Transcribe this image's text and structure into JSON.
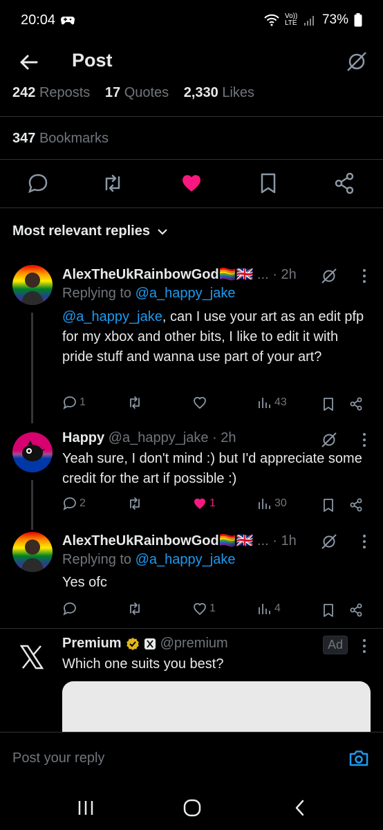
{
  "status_bar": {
    "time": "20:04",
    "network": "Vo)) LTE",
    "battery": "73%"
  },
  "header": {
    "title": "Post"
  },
  "stats": {
    "reposts_count": "242",
    "reposts_label": "Reposts",
    "quotes_count": "17",
    "quotes_label": "Quotes",
    "likes_count": "2,330",
    "likes_label": "Likes",
    "bookmarks_count": "347",
    "bookmarks_label": "Bookmarks"
  },
  "sort": {
    "label": "Most relevant replies"
  },
  "replies": [
    {
      "name": "AlexTheUkRainbowGod🏳️‍🌈🇬🇧",
      "meta": " ... · 2h",
      "replying_prefix": "Replying to ",
      "replying_to": "@a_happy_jake",
      "text_mention": "@a_happy_jake",
      "text": ", can I use your art as an edit pfp for my xbox and other bits, I like to edit it with pride stuff and wanna use part of your art?",
      "replies": "1",
      "reposts": "",
      "likes": "",
      "views": "43"
    },
    {
      "name": "Happy",
      "meta": " @a_happy_jake · 2h",
      "text": "Yeah sure, I don't mind :) but I'd appreciate some credit for the art if possible :)",
      "replies": "2",
      "reposts": "",
      "likes": "1",
      "views": "30"
    },
    {
      "name": "AlexTheUkRainbowGod🏳️‍🌈🇬🇧",
      "meta": " ... · 1h",
      "replying_prefix": "Replying to ",
      "replying_to": "@a_happy_jake",
      "text": "Yes ofc",
      "replies": "",
      "reposts": "",
      "likes": "1",
      "views": "4"
    }
  ],
  "ad": {
    "name": "Premium",
    "handle": "@premium",
    "badge": "Ad",
    "text": "Which one suits you best?"
  },
  "compose": {
    "placeholder": "Post your reply"
  },
  "colors": {
    "accent": "#1d9bf0",
    "like": "#f91880",
    "muted": "#71767b",
    "text": "#e7e9ea"
  }
}
